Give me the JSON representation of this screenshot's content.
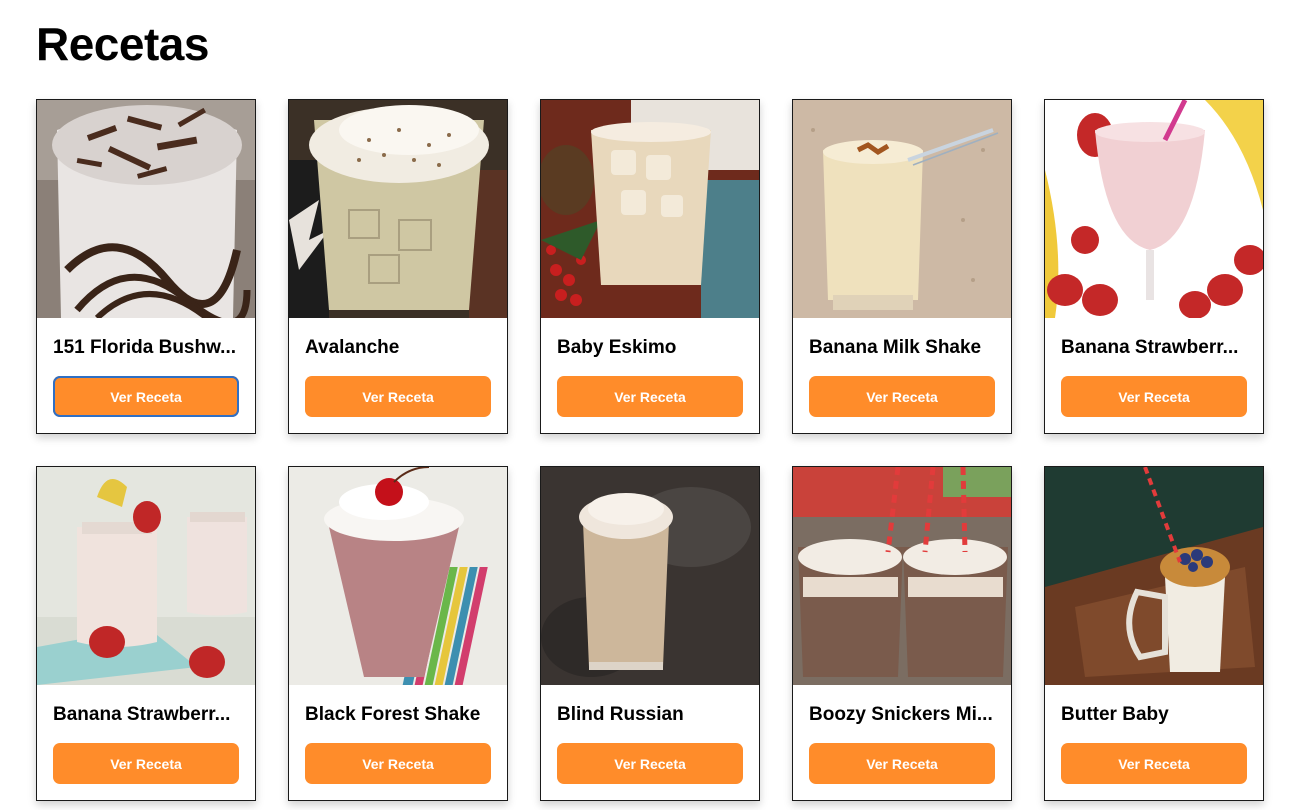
{
  "page": {
    "title": "Recetas"
  },
  "button_label": "Ver Receta",
  "colors": {
    "button": "#ff8c2a",
    "focus_ring": "#2f6fc4"
  },
  "recipes": [
    {
      "name": "151 Florida Bushw...",
      "image": "chocolate-shake-photo"
    },
    {
      "name": "Avalanche",
      "image": "creamy-iced-drink-photo"
    },
    {
      "name": "Baby Eskimo",
      "image": "iced-milk-drink-photo"
    },
    {
      "name": "Banana Milk Shake",
      "image": "banana-shake-with-straw-photo"
    },
    {
      "name": "Banana Strawberr...",
      "image": "strawberry-banana-smoothie-photo"
    },
    {
      "name": "Banana Strawberr...",
      "image": "smoothie-jars-photo"
    },
    {
      "name": "Black Forest Shake",
      "image": "cherry-shake-photo"
    },
    {
      "name": "Blind Russian",
      "image": "foamy-coffee-drink-photo"
    },
    {
      "name": "Boozy Snickers Mi...",
      "image": "snickers-milkshake-jars-photo"
    },
    {
      "name": "Butter Baby",
      "image": "blueberry-shake-mug-photo"
    }
  ]
}
